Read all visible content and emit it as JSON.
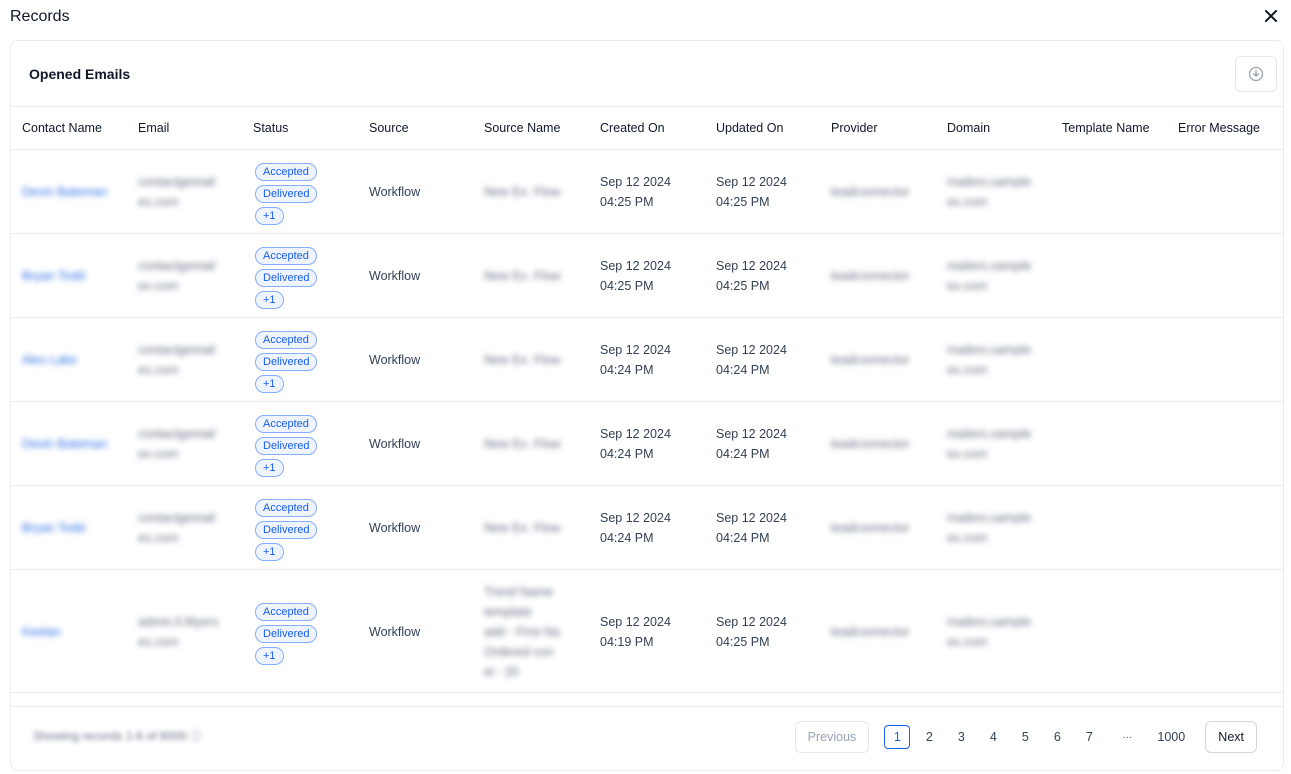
{
  "modal": {
    "title": "Records"
  },
  "card": {
    "title": "Opened Emails"
  },
  "columns": [
    "Contact Name",
    "Email",
    "Status",
    "Source",
    "Source Name",
    "Created On",
    "Updated On",
    "Provider",
    "Domain",
    "Template Name",
    "Error Message"
  ],
  "rows": [
    {
      "contact": "Devin Bateman",
      "email": [
        "contactgemail",
        "ex.com"
      ],
      "status": [
        "Accepted",
        "Delivered",
        "+1"
      ],
      "source": "Workflow",
      "source_name": [
        "New Ex. Flow"
      ],
      "created": [
        "Sep 12 2024",
        "04:25 PM"
      ],
      "updated": [
        "Sep 12 2024",
        "04:25 PM"
      ],
      "provider": "leadconnector",
      "domain": [
        "mailers.sample",
        "ex.com"
      ]
    },
    {
      "contact": "Bryan Todd",
      "email": [
        "contactgemail",
        "ex.com"
      ],
      "status": [
        "Accepted",
        "Delivered",
        "+1"
      ],
      "source": "Workflow",
      "source_name": [
        "New Ex. Flow"
      ],
      "created": [
        "Sep 12 2024",
        "04:25 PM"
      ],
      "updated": [
        "Sep 12 2024",
        "04:25 PM"
      ],
      "provider": "leadconnector",
      "domain": [
        "mailers.sample",
        "ex.com"
      ]
    },
    {
      "contact": "Alex Lake",
      "email": [
        "contactgemail",
        "ex.com"
      ],
      "status": [
        "Accepted",
        "Delivered",
        "+1"
      ],
      "source": "Workflow",
      "source_name": [
        "New Ex. Flow"
      ],
      "created": [
        "Sep 12 2024",
        "04:24 PM"
      ],
      "updated": [
        "Sep 12 2024",
        "04:24 PM"
      ],
      "provider": "leadconnector",
      "domain": [
        "mailers.sample",
        "ex.com"
      ]
    },
    {
      "contact": "Devin Bateman",
      "email": [
        "contactgemail",
        "ex.com"
      ],
      "status": [
        "Accepted",
        "Delivered",
        "+1"
      ],
      "source": "Workflow",
      "source_name": [
        "New Ex. Flow"
      ],
      "created": [
        "Sep 12 2024",
        "04:24 PM"
      ],
      "updated": [
        "Sep 12 2024",
        "04:24 PM"
      ],
      "provider": "leadconnector",
      "domain": [
        "mailers.sample",
        "ex.com"
      ]
    },
    {
      "contact": "Bryan Todd",
      "email": [
        "contactgemail",
        "ex.com"
      ],
      "status": [
        "Accepted",
        "Delivered",
        "+1"
      ],
      "source": "Workflow",
      "source_name": [
        "New Ex. Flow"
      ],
      "created": [
        "Sep 12 2024",
        "04:24 PM"
      ],
      "updated": [
        "Sep 12 2024",
        "04:24 PM"
      ],
      "provider": "leadconnector",
      "domain": [
        "mailers.sample",
        "ex.com"
      ]
    },
    {
      "contact": "Keelan",
      "email": [
        "admin.ll.Myers",
        "ex.com"
      ],
      "status": [
        "Accepted",
        "Delivered",
        "+1"
      ],
      "source": "Workflow",
      "source_name": [
        "Trend Name",
        "template",
        "add - First Na",
        "Ordered con",
        "el - 20"
      ],
      "created": [
        "Sep 12 2024",
        "04:19 PM"
      ],
      "updated": [
        "Sep 12 2024",
        "04:25 PM"
      ],
      "provider": "leadconnector",
      "domain": [
        "mailers.sample",
        "ex.com"
      ]
    }
  ],
  "footer": {
    "showing": "Showing records 1-6 of 6000",
    "previous": "Previous",
    "next": "Next",
    "pages": [
      "1",
      "2",
      "3",
      "4",
      "5",
      "6",
      "7",
      "···",
      "1000"
    ],
    "active_page": "1"
  },
  "icons": {
    "close": "close-icon",
    "download": "download-icon",
    "info": "info-icon"
  }
}
